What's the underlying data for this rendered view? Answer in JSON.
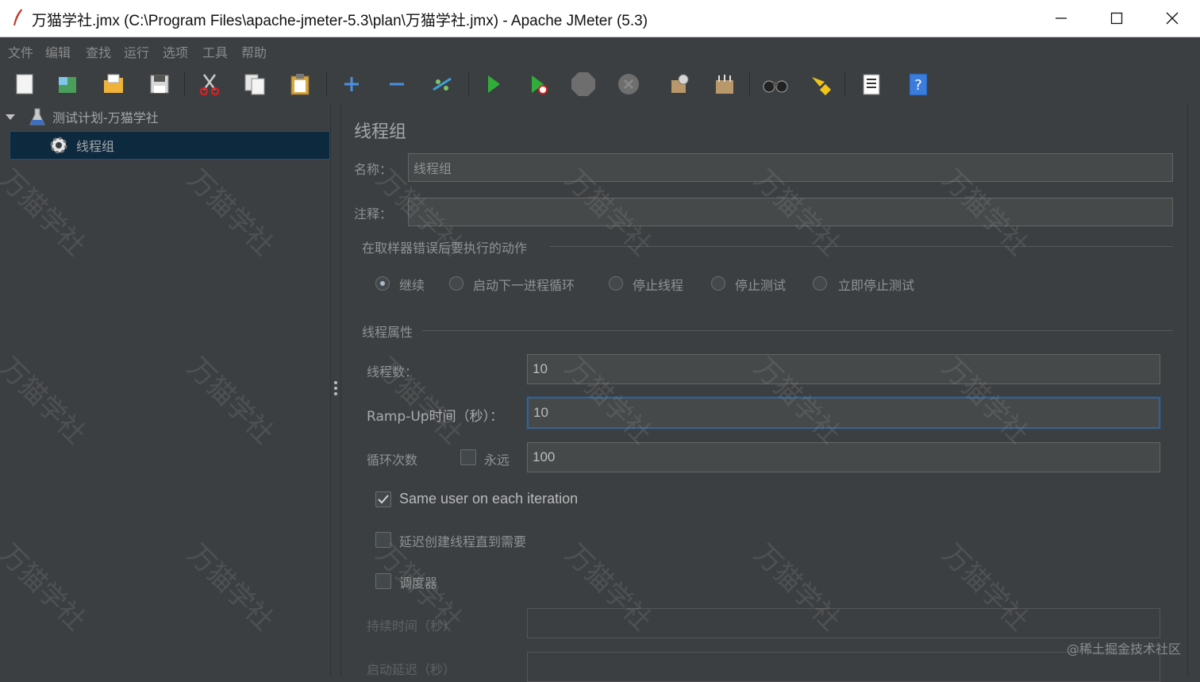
{
  "window": {
    "title": "万猫学社.jmx (C:\\Program Files\\apache-jmeter-5.3\\plan\\万猫学社.jmx) - Apache JMeter (5.3)"
  },
  "menu": [
    "文件",
    "编辑",
    "查找",
    "运行",
    "选项",
    "工具",
    "帮助"
  ],
  "toolbar": {
    "icons": [
      "new-icon",
      "templates-icon",
      "open-icon",
      "save-icon",
      "cut-icon",
      "copy-icon",
      "paste-icon",
      "expand-icon",
      "collapse-icon",
      "toggle-icon",
      "start-icon",
      "start-no-pause-icon",
      "stop-icon",
      "shutdown-icon",
      "clear-icon",
      "clear-all-icon",
      "search-icon",
      "reset-search-icon",
      "function-helper-icon",
      "help-icon"
    ]
  },
  "tree": {
    "root_label": "测试计划-万猫学社",
    "child_label": "线程组"
  },
  "panel": {
    "title": "线程组",
    "name_label": "名称：",
    "name_value": "线程组",
    "comment_label": "注释：",
    "comment_value": "",
    "error_section": "在取样器错误后要执行的动作",
    "error_options": [
      "继续",
      "启动下一进程循环",
      "停止线程",
      "停止测试",
      "立即停止测试"
    ],
    "error_selected": 0,
    "props_section": "线程属性",
    "threads_label": "线程数：",
    "threads_value": "10",
    "rampup_label": "Ramp-Up时间（秒）：",
    "rampup_value": "10",
    "loop_label": "循环次数",
    "forever_label": "永远",
    "forever_checked": false,
    "loop_value": "100",
    "same_user_label": "Same user on each iteration",
    "same_user_checked": true,
    "delay_label": "延迟创建线程直到需要",
    "delay_checked": false,
    "scheduler_label": "调度器",
    "scheduler_checked": false,
    "duration_label": "持续时间（秒）",
    "duration_value": "",
    "startup_delay_label": "启动延迟（秒）",
    "startup_delay_value": ""
  },
  "watermark": {
    "text": "万猫学社",
    "site": "@稀土掘金技术社区"
  },
  "colors": {
    "background": "#3c3f41",
    "selection": "#0d293e",
    "field": "#45494a",
    "focus_border": "#3d6185"
  }
}
